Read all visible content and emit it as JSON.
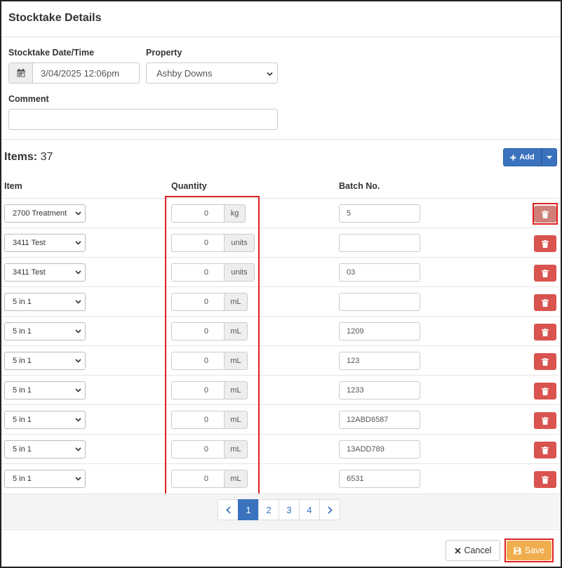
{
  "header": {
    "title": "Stocktake Details"
  },
  "form": {
    "date_label": "Stocktake Date/Time",
    "date_value": "3/04/2025 12:06pm",
    "property_label": "Property",
    "property_value": "Ashby Downs",
    "comment_label": "Comment",
    "comment_value": ""
  },
  "items": {
    "count_label": "Items:",
    "count": "37",
    "add_label": "Add",
    "columns": {
      "item": "Item",
      "quantity": "Quantity",
      "batch": "Batch No."
    },
    "rows": [
      {
        "item": "2700 Treatment",
        "qty": "0",
        "unit": "kg",
        "batch": "5"
      },
      {
        "item": "3411 Test",
        "qty": "0",
        "unit": "units",
        "batch": ""
      },
      {
        "item": "3411 Test",
        "qty": "0",
        "unit": "units",
        "batch": "03"
      },
      {
        "item": "5 in 1",
        "qty": "0",
        "unit": "mL",
        "batch": ""
      },
      {
        "item": "5 in 1",
        "qty": "0",
        "unit": "mL",
        "batch": "1209"
      },
      {
        "item": "5 in 1",
        "qty": "0",
        "unit": "mL",
        "batch": "123"
      },
      {
        "item": "5 in 1",
        "qty": "0",
        "unit": "mL",
        "batch": "1233"
      },
      {
        "item": "5 in 1",
        "qty": "0",
        "unit": "mL",
        "batch": "12ABD6587"
      },
      {
        "item": "5 in 1",
        "qty": "0",
        "unit": "mL",
        "batch": "13ADD789"
      },
      {
        "item": "5 in 1",
        "qty": "0",
        "unit": "mL",
        "batch": "6531"
      }
    ]
  },
  "pagination": {
    "pages": [
      "1",
      "2",
      "3",
      "4"
    ],
    "current": "1"
  },
  "footer": {
    "cancel_label": "Cancel",
    "save_label": "Save"
  },
  "colors": {
    "primary": "#3a72be",
    "danger": "#d9534f",
    "warning": "#f0ad4e",
    "highlight": "#e02020"
  },
  "icons": {
    "date": "calendar-icon",
    "add": "plus-icon",
    "delete": "trash-icon",
    "prev": "chevron-left-icon",
    "next": "chevron-right-icon",
    "cancel": "close-icon",
    "save": "save-icon"
  }
}
